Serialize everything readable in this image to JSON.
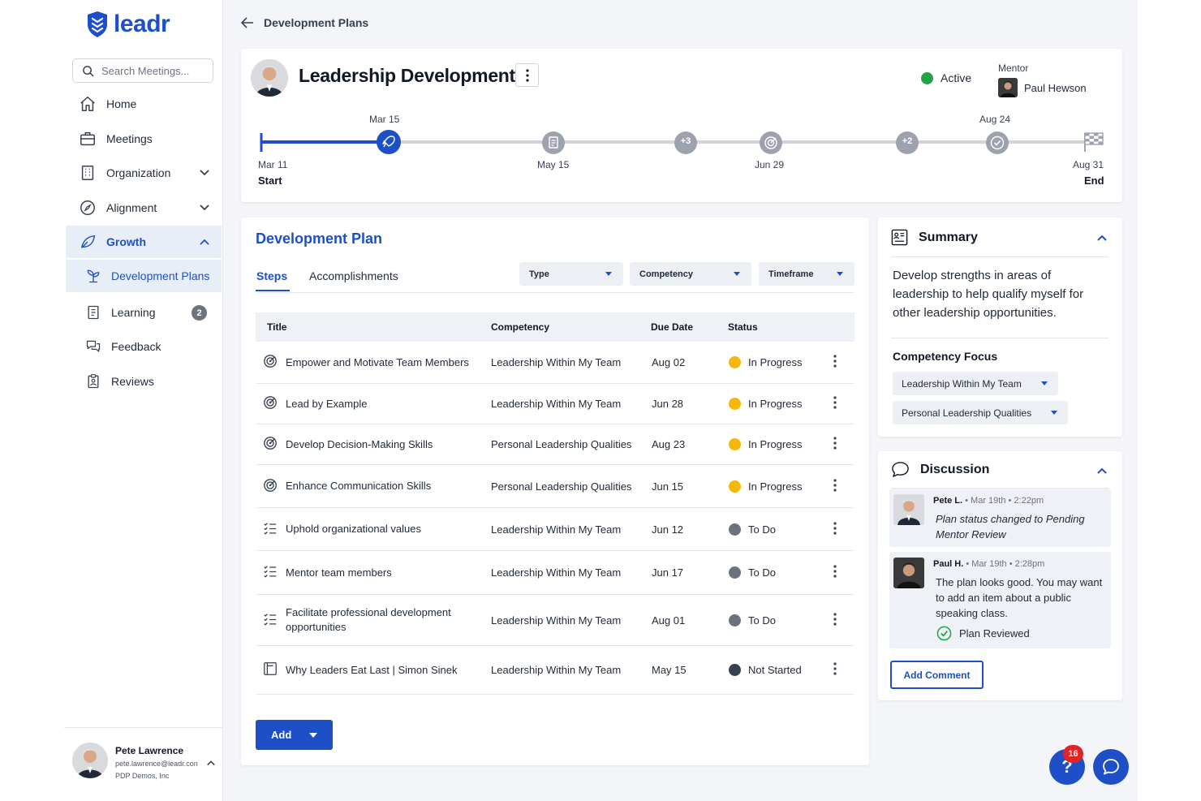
{
  "app": {
    "logo_text": "leadr"
  },
  "sidebar": {
    "search_placeholder": "Search Meetings...",
    "items": [
      {
        "label": "Home"
      },
      {
        "label": "Meetings"
      },
      {
        "label": "Organization"
      },
      {
        "label": "Alignment"
      },
      {
        "label": "Growth"
      },
      {
        "label": "Development Plans"
      },
      {
        "label": "Learning",
        "badge": "2"
      },
      {
        "label": "Feedback"
      },
      {
        "label": "Reviews"
      }
    ],
    "user": {
      "name": "Pete Lawrence",
      "email": "pete.lawrence@leadr.con",
      "org": "PDP Demos, Inc"
    }
  },
  "header": {
    "back_label": "Development Plans"
  },
  "plan": {
    "title": "Leadership Development",
    "status": "Active",
    "status_color": "#22a347",
    "mentor_label": "Mentor",
    "mentor_name": "Paul Hewson",
    "timeline": {
      "start_date": "Mar 11",
      "start_label": "Start",
      "end_date": "Aug 31",
      "end_label": "End",
      "milestones_above": [
        "Mar 15",
        "Aug 24"
      ],
      "milestones_below": [
        "May 15",
        "Jun 29"
      ],
      "cluster_counts": [
        "+3",
        "+2"
      ],
      "progress": 0.15
    }
  },
  "dev_plan": {
    "title": "Development Plan",
    "tabs": [
      {
        "label": "Steps"
      },
      {
        "label": "Accomplishments"
      }
    ],
    "filters": [
      {
        "label": "Type"
      },
      {
        "label": "Competency"
      },
      {
        "label": "Timeframe"
      }
    ],
    "columns": [
      "Title",
      "Competency",
      "Due Date",
      "Status"
    ],
    "rows": [
      {
        "icon": "target-icon",
        "title": "Empower and Motivate Team Members",
        "competency": "Leadership Within My Team",
        "due": "Aug 02",
        "status": "In Progress"
      },
      {
        "icon": "target-icon",
        "title": "Lead by Example",
        "competency": "Leadership Within My Team",
        "due": "Jun 28",
        "status": "In Progress"
      },
      {
        "icon": "target-icon",
        "title": "Develop Decision-Making Skills",
        "competency": "Personal Leadership Qualities",
        "due": "Aug 23",
        "status": "In Progress"
      },
      {
        "icon": "target-icon",
        "title": "Enhance Communication Skills",
        "competency": "Personal Leadership Qualities",
        "due": "Jun 15",
        "status": "In Progress"
      },
      {
        "icon": "checklist-icon",
        "title": "Uphold organizational values",
        "competency": "Leadership Within My Team",
        "due": "Jun 12",
        "status": "To Do"
      },
      {
        "icon": "checklist-icon",
        "title": "Mentor team members",
        "competency": "Leadership Within My Team",
        "due": "Jun 17",
        "status": "To Do"
      },
      {
        "icon": "checklist-icon",
        "title": "Facilitate professional development opportunities",
        "competency": "Leadership Within My Team",
        "due": "Aug 01",
        "status": "To Do"
      },
      {
        "icon": "book-icon",
        "title": "Why Leaders Eat Last | Simon Sinek",
        "competency": "Leadership Within My Team",
        "due": "May 15",
        "status": "Not Started"
      }
    ],
    "status_colors": {
      "In Progress": "#f5b70a",
      "To Do": "#6b7280",
      "Not Started": "#374151"
    },
    "add_label": "Add"
  },
  "summary": {
    "title": "Summary",
    "text": "Develop strengths in areas of leadership to help qualify myself for other leadership opportunities.",
    "competency_focus_label": "Competency Focus",
    "competencies": [
      "Leadership Within My Team",
      "Personal Leadership Qualities"
    ]
  },
  "discussion": {
    "title": "Discussion",
    "comments": [
      {
        "author": "Pete L.",
        "meta": " • Mar 19th • 2:22pm",
        "text": "Plan status changed to Pending Mentor Review",
        "italic": true
      },
      {
        "author": "Paul H.",
        "meta": " • Mar 19th • 2:28pm",
        "text": "The plan looks good. You may want to add an item about a public speaking class.",
        "italic": false,
        "status": "Plan Reviewed"
      }
    ],
    "add_comment_label": "Add Comment"
  },
  "floating": {
    "help_label": "?",
    "notification_count": "16"
  }
}
